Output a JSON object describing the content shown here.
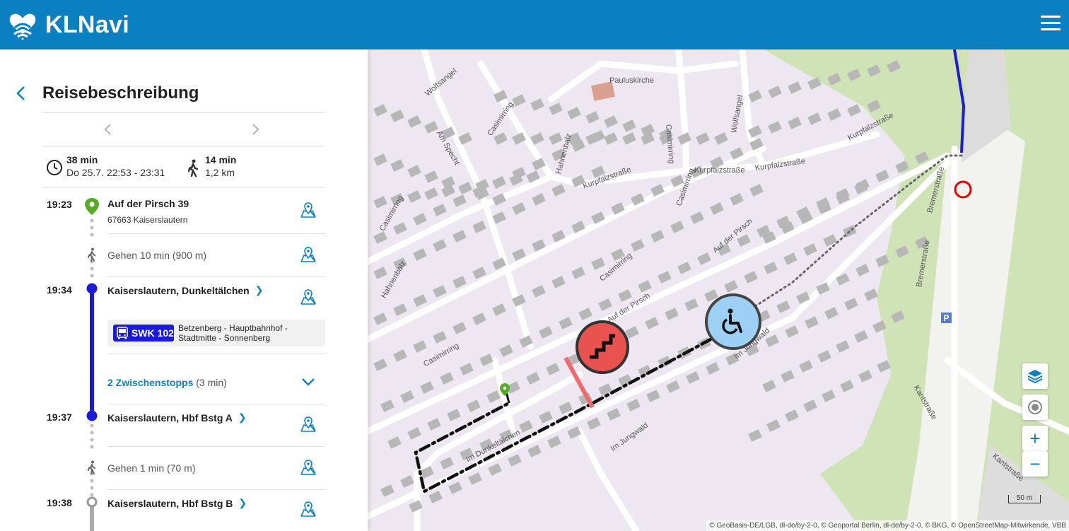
{
  "app": {
    "title": "KLNavi",
    "logo": "wifi-heart-logo",
    "menu_icon": "hamburger-menu-icon",
    "brand_color": "#0a80c0"
  },
  "trip": {
    "title": "Reisebeschreibung",
    "duration": "38 min",
    "date_time": "Do 25.7. 22:53 - 23:31",
    "walk_duration": "14 min",
    "walk_distance": "1,2 km"
  },
  "legs": {
    "start": {
      "time": "19:23",
      "name": "Auf der Pirsch 39",
      "address": "67663 Kaiserslautern"
    },
    "walk1": {
      "text": "Gehen 10 min (900 m)"
    },
    "board": {
      "time": "19:34",
      "name": "Kaiserslautern, Dunkeltälchen"
    },
    "bus": {
      "line": "SWK 102",
      "destination": "Betzenberg - Hauptbahnhof - Stadtmitte - Sonnenberg",
      "color": "#1a1adc"
    },
    "intermediate": {
      "label": "2 Zwischenstopps",
      "duration": "(3 min)"
    },
    "alight": {
      "time": "19:37",
      "name": "Kaiserslautern, Hbf Bstg A"
    },
    "walk2": {
      "text": "Gehen 1 min (70 m)"
    },
    "next": {
      "time": "19:38",
      "name": "Kaiserslautern, Hbf Bstg B"
    }
  },
  "map": {
    "labels": {
      "pauluskirche": "Pauluskirche",
      "wolfsangel1": "Wolfsangel",
      "wolfsangel2": "Wolfsangel",
      "am_specht": "Am Specht",
      "casimirring1": "Casimirring",
      "casimirring2": "Casimirring",
      "casimirring3": "Casimirring",
      "casimirring4": "Casimirring",
      "casimirring5": "Casimirring",
      "casimirring6": "Casimirring",
      "hahnenbalz1": "Hahnenbalz",
      "hahnenbalz2": "Hahnenbalz",
      "kurpfalz1": "Kurpfalzstraße",
      "kurpfalz2": "Kurpfalzstraße",
      "kurpfalz3": "Kurpfalzstraße",
      "kurpfalz4": "Kurpfalzstraße",
      "auf_der_pirsch1": "Auf der Pirsch",
      "auf_der_pirsch2": "Auf der Pirsch",
      "im_jungwald1": "Im Jungwald",
      "im_jungwald2": "Im Jungwald",
      "im_dunkeltaelchen": "Im Dunkeltälchen",
      "bremerstrasse1": "Bremerstraße",
      "bremerstrasse2": "Bremerstraße",
      "kantstrasse1": "Kantstraße",
      "kantstrasse2": "Kantstraße",
      "parking": "P"
    },
    "scale": "50 m",
    "attribution": "© GeoBasis-DE/LGB, dl-de/by-2-0, © Geoportal Berlin, dl-de/by-2-0, © BKG, © OpenStreetMap-Mitwirkende, VBB",
    "controls": {
      "layers": "layers-icon",
      "locate": "locate-icon",
      "zoom_in": "+",
      "zoom_out": "−"
    },
    "markers": {
      "stairs": "stairs-icon",
      "wheelchair": "wheelchair-icon"
    }
  }
}
